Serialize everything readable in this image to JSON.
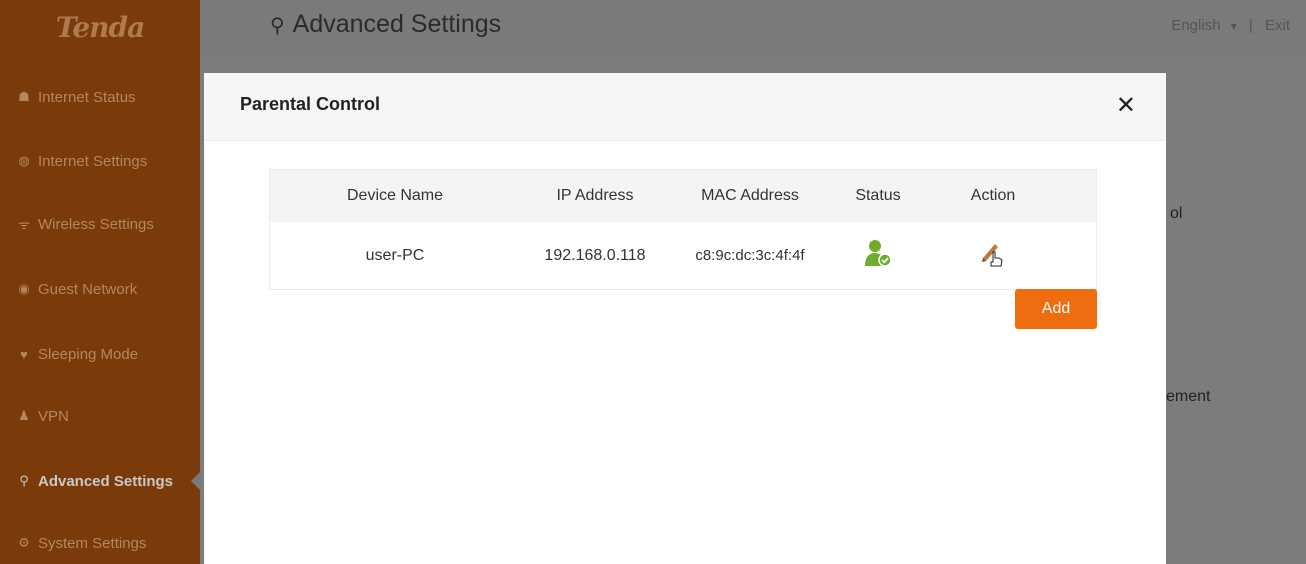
{
  "app": {
    "logo": "Tenda"
  },
  "header": {
    "title": "Advanced Settings",
    "language": "English",
    "lang_caret": "▾",
    "separator": "|",
    "exit": "Exit"
  },
  "sidebar": {
    "items": [
      {
        "label": "Internet Status",
        "icon": "router-icon"
      },
      {
        "label": "Internet Settings",
        "icon": "globe-icon"
      },
      {
        "label": "Wireless Settings",
        "icon": "wifi-icon"
      },
      {
        "label": "Guest Network",
        "icon": "guest-icon"
      },
      {
        "label": "Sleeping Mode",
        "icon": "bulb-icon"
      },
      {
        "label": "VPN",
        "icon": "vpn-icon"
      },
      {
        "label": "Advanced Settings",
        "icon": "wrench-icon",
        "active": true
      },
      {
        "label": "System Settings",
        "icon": "gear-icon"
      }
    ]
  },
  "background": {
    "text1": "ol",
    "text2": "ement"
  },
  "modal": {
    "title": "Parental Control",
    "close": "✕",
    "table": {
      "headers": [
        "Device Name",
        "IP Address",
        "MAC Address",
        "Status",
        "Action"
      ],
      "rows": [
        {
          "device_name": "user-PC",
          "ip": "192.168.0.118",
          "mac": "c8:9c:dc:3c:4f:4f",
          "status": "online-user-icon",
          "action": "edit-icon"
        }
      ]
    },
    "add_label": "Add"
  },
  "colors": {
    "accent": "#ef6c0f",
    "sidebar": "#7a3a09",
    "status_green": "#6fae2c"
  }
}
